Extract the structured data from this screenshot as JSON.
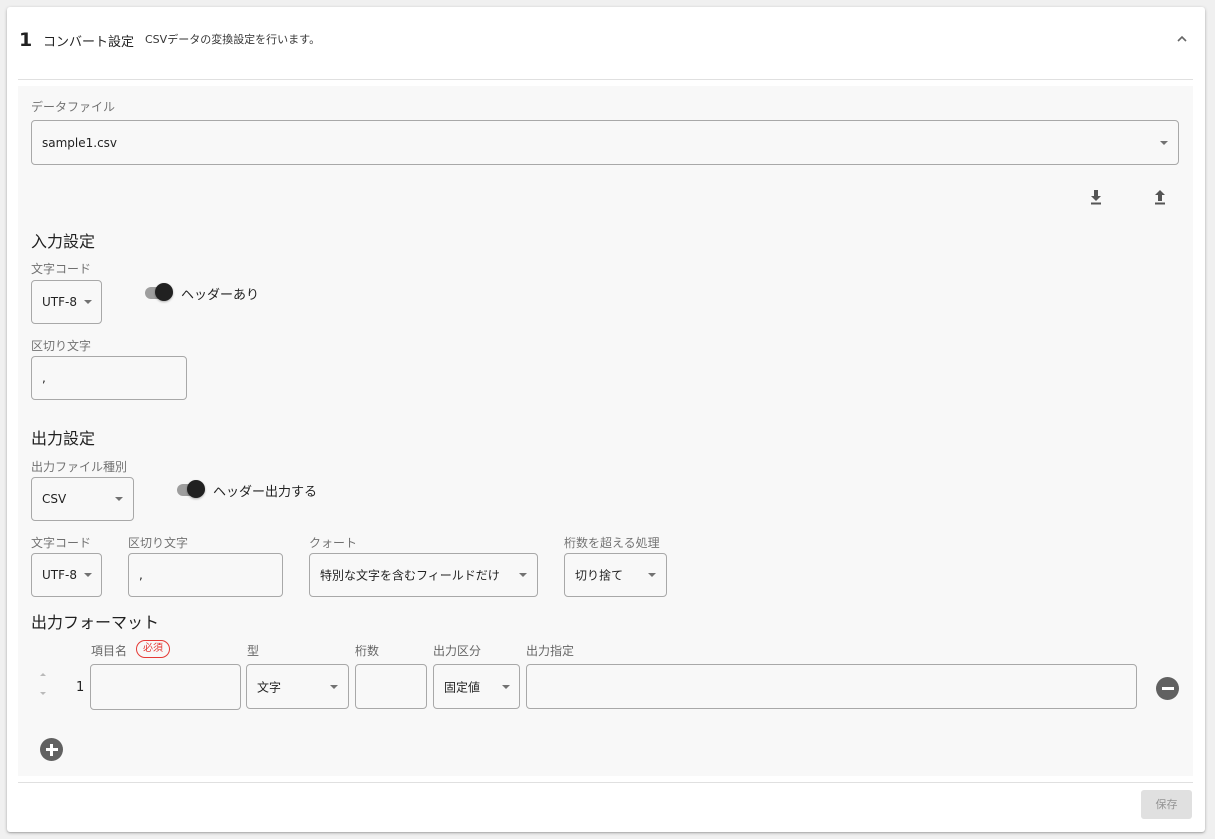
{
  "step": {
    "number": "1",
    "title": "コンバート設定",
    "description": "CSVデータの変換設定を行います。"
  },
  "data_file": {
    "label": "データファイル",
    "value": "sample1.csv"
  },
  "input_settings": {
    "title": "入力設定",
    "encoding_label": "文字コード",
    "encoding_value": "UTF-8",
    "header_toggle_label": "ヘッダーあり",
    "header_toggle_on": true,
    "delimiter_label": "区切り文字",
    "delimiter_value": ","
  },
  "output_settings": {
    "title": "出力設定",
    "file_type_label": "出力ファイル種別",
    "file_type_value": "CSV",
    "header_toggle_label": "ヘッダー出力する",
    "header_toggle_on": true,
    "encoding_label": "文字コード",
    "encoding_value": "UTF-8",
    "delimiter_label": "区切り文字",
    "delimiter_value": ",",
    "quote_label": "クォート",
    "quote_value": "特別な文字を含むフィールドだけ",
    "overflow_label": "桁数を超える処理",
    "overflow_value": "切り捨て"
  },
  "output_format": {
    "title": "出力フォーマット",
    "columns": {
      "name": "項目名",
      "required_badge": "必須",
      "type": "型",
      "digits": "桁数",
      "output_kind": "出力区分",
      "output_spec": "出力指定"
    },
    "rows": [
      {
        "index": "1",
        "name": "",
        "type": "文字",
        "digits": "",
        "output_kind": "固定値",
        "output_spec": ""
      }
    ]
  },
  "footer": {
    "save_label": "保存"
  },
  "icons": {
    "collapse": "chevron-up-icon",
    "download": "download-icon",
    "upload": "upload-icon",
    "move_up": "arrow-up-icon",
    "move_down": "arrow-down-icon",
    "remove": "remove-circle-icon",
    "add": "add-circle-icon"
  },
  "colors": {
    "required_badge": "#e53935",
    "toggle_thumb": "#212121",
    "panel_background": "#f8f8f8"
  }
}
